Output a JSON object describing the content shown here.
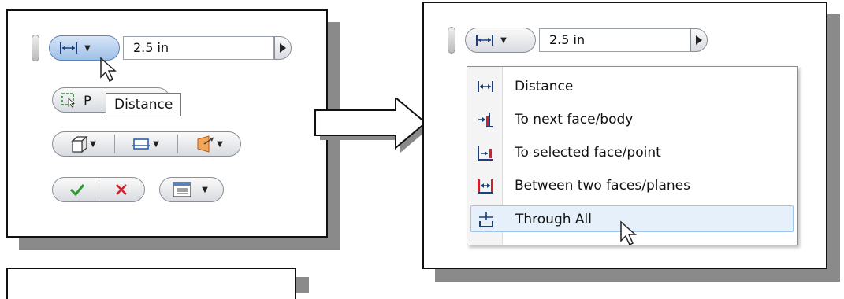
{
  "left_panel": {
    "distance_value": "2.5 in",
    "tooltip": "Distance",
    "profile_label_partial": "P"
  },
  "right_panel": {
    "distance_value": "2.5 in",
    "menu_items": [
      {
        "label": "Distance",
        "icon": "distance-icon"
      },
      {
        "label": "To next face/body",
        "icon": "to-next-icon"
      },
      {
        "label": "To selected face/point",
        "icon": "to-selected-icon"
      },
      {
        "label": "Between two faces/planes",
        "icon": "between-icon"
      },
      {
        "label": "Through All",
        "icon": "through-all-icon",
        "highlighted": true
      }
    ]
  },
  "colors": {
    "accent_red": "#d0202a",
    "accent_blue": "#2b5fa8",
    "check_green": "#2e9a2e"
  }
}
